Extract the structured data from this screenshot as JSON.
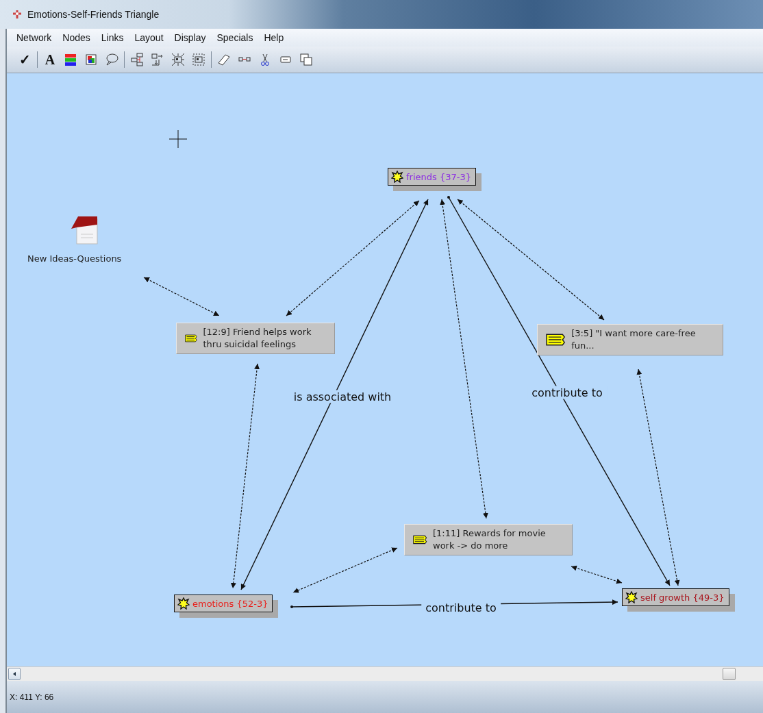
{
  "window": {
    "title": "Emotions-Self-Friends Triangle"
  },
  "menu": [
    "Network",
    "Nodes",
    "Links",
    "Layout",
    "Display",
    "Specials",
    "Help"
  ],
  "toolbar": [
    {
      "kind": "check",
      "glyph": "✓"
    },
    {
      "kind": "separator"
    },
    {
      "kind": "font",
      "glyph": "A"
    },
    {
      "kind": "colors"
    },
    {
      "kind": "image"
    },
    {
      "kind": "comment"
    },
    {
      "kind": "separator"
    },
    {
      "kind": "tree"
    },
    {
      "kind": "import"
    },
    {
      "kind": "expand"
    },
    {
      "kind": "frame"
    },
    {
      "kind": "separator"
    },
    {
      "kind": "eraser"
    },
    {
      "kind": "link"
    },
    {
      "kind": "cut"
    },
    {
      "kind": "label"
    },
    {
      "kind": "copy"
    }
  ],
  "nodes": [
    {
      "kind": "concept",
      "label": "friends {37-3}",
      "color": "#8b2be2"
    },
    {
      "kind": "document",
      "label": "New Ideas-Questions"
    },
    {
      "kind": "note",
      "label": "[12:9] Friend helps work thru suicidal feelings"
    },
    {
      "kind": "note",
      "label": "[3:5] \"I want more care-free fun..."
    },
    {
      "kind": "note",
      "label": "[1:11] Rewards for movie work -> do more"
    },
    {
      "kind": "concept",
      "label": "emotions {52-3}",
      "color": "#e8201c"
    },
    {
      "kind": "concept",
      "label": "self growth {49-3}",
      "color": "#a8141c"
    }
  ],
  "links": [
    {
      "kind": "dashed"
    },
    {
      "kind": "dashed"
    },
    {
      "kind": "solid",
      "label": "is associated with"
    },
    {
      "kind": "dashed"
    },
    {
      "kind": "solid",
      "label": "contribute to"
    },
    {
      "kind": "dashed"
    },
    {
      "kind": "dashed"
    },
    {
      "kind": "dashed"
    },
    {
      "kind": "dashed"
    },
    {
      "kind": "dashed"
    },
    {
      "kind": "solid",
      "label": "contribute to"
    }
  ],
  "status_bar": "X: 411 Y: 66"
}
